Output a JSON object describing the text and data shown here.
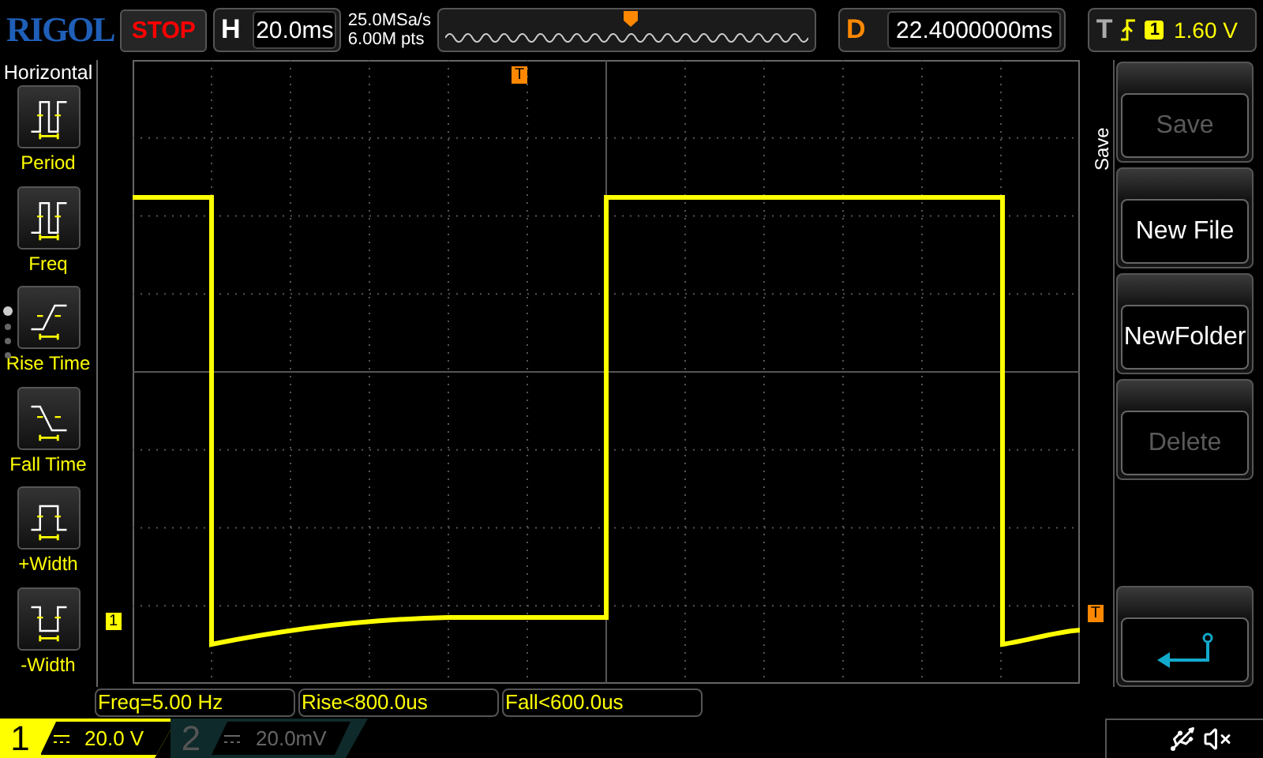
{
  "header": {
    "logo": "RIGOL",
    "run_state": "STOP",
    "timebase": {
      "label": "H",
      "value": "20.0ms"
    },
    "sample_rate": "25.0MSa/s",
    "memory_depth": "6.00M pts",
    "delay": {
      "label": "D",
      "value": "22.4000000ms"
    },
    "trigger": {
      "label": "T",
      "source": "1",
      "level": "1.60 V"
    }
  },
  "sidebar": {
    "title": "Horizontal",
    "items": [
      {
        "kind": "period",
        "label": "Period"
      },
      {
        "kind": "freq",
        "label": "Freq"
      },
      {
        "kind": "rise",
        "label": "Rise Time"
      },
      {
        "kind": "fall",
        "label": "Fall Time"
      },
      {
        "kind": "pwidth",
        "label": "+Width"
      },
      {
        "kind": "nwidth",
        "label": "-Width"
      }
    ]
  },
  "markers": {
    "trigger_position": "T",
    "channel_1": "1",
    "trigger_level": "T"
  },
  "menu": {
    "title": "Save",
    "buttons": [
      {
        "kind": "text",
        "label": "Save",
        "disabled": true
      },
      {
        "kind": "text",
        "label": "New File",
        "disabled": false
      },
      {
        "kind": "text",
        "label": "NewFolder",
        "disabled": false
      },
      {
        "kind": "text",
        "label": "Delete",
        "disabled": true
      },
      {
        "kind": "spacer"
      },
      {
        "kind": "back"
      }
    ]
  },
  "measurements": [
    "Freq=5.00 Hz",
    "Rise<800.0us",
    "Fall<600.0us"
  ],
  "channels": [
    {
      "number": "1",
      "scale": "20.0 V",
      "active": true
    },
    {
      "number": "2",
      "scale": "20.0mV",
      "active": false
    }
  ]
}
